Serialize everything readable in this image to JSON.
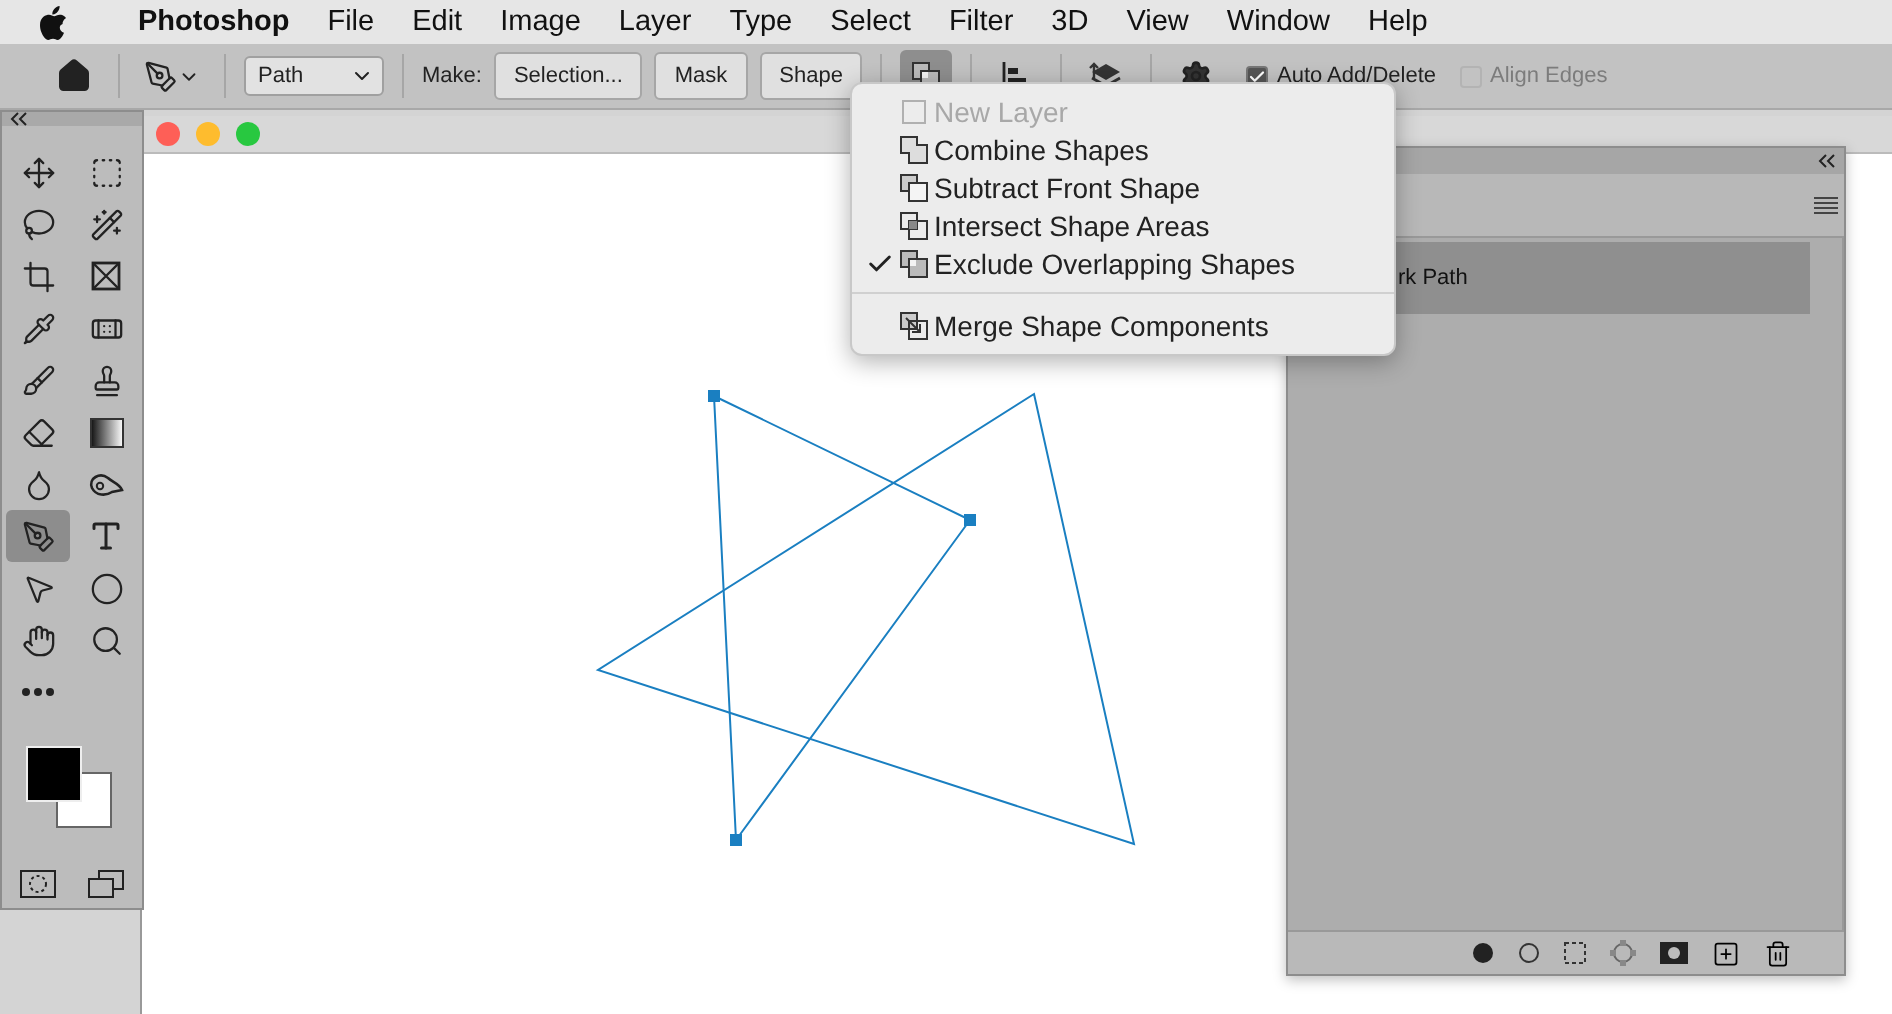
{
  "menubar": {
    "app": "Photoshop",
    "items": [
      "File",
      "Edit",
      "Image",
      "Layer",
      "Type",
      "Select",
      "Filter",
      "3D",
      "View",
      "Window",
      "Help"
    ]
  },
  "options_bar": {
    "path_mode": "Path",
    "make_label": "Make:",
    "make_buttons": [
      "Selection...",
      "Mask",
      "Shape"
    ],
    "path_operations_open": true,
    "auto_add_delete": {
      "label": "Auto Add/Delete",
      "checked": true
    },
    "align_edges": {
      "label": "Align Edges",
      "checked": false,
      "disabled": true
    }
  },
  "toolbox": {
    "tools": [
      {
        "kind": "move",
        "selected": false
      },
      {
        "kind": "marquee",
        "selected": false
      },
      {
        "kind": "lasso",
        "selected": false
      },
      {
        "kind": "wand",
        "selected": false
      },
      {
        "kind": "crop",
        "selected": false
      },
      {
        "kind": "frame",
        "selected": false
      },
      {
        "kind": "eyedropper",
        "selected": false
      },
      {
        "kind": "healing",
        "selected": false
      },
      {
        "kind": "brush",
        "selected": false
      },
      {
        "kind": "stamp",
        "selected": false
      },
      {
        "kind": "eraser",
        "selected": false
      },
      {
        "kind": "gradient",
        "selected": false
      },
      {
        "kind": "blur",
        "selected": false
      },
      {
        "kind": "smudge",
        "selected": false
      },
      {
        "kind": "pen",
        "selected": true
      },
      {
        "kind": "type",
        "selected": false
      },
      {
        "kind": "path-select",
        "selected": false
      },
      {
        "kind": "ellipse",
        "selected": false
      },
      {
        "kind": "hand",
        "selected": false
      },
      {
        "kind": "zoom",
        "selected": false
      },
      {
        "kind": "more",
        "selected": false
      }
    ]
  },
  "paths_panel": {
    "rows": [
      {
        "label": "rk Path",
        "selected": true
      }
    ]
  },
  "shape_operations_menu": {
    "items": [
      {
        "kind": "new-layer",
        "label": "New Layer",
        "disabled": true,
        "checked": false
      },
      {
        "kind": "combine",
        "label": "Combine Shapes",
        "disabled": false,
        "checked": false
      },
      {
        "kind": "subtract",
        "label": "Subtract Front Shape",
        "disabled": false,
        "checked": false
      },
      {
        "kind": "intersect",
        "label": "Intersect Shape Areas",
        "disabled": false,
        "checked": false
      },
      {
        "kind": "exclude",
        "label": "Exclude Overlapping Shapes",
        "disabled": false,
        "checked": true
      }
    ],
    "footer_items": [
      {
        "kind": "merge",
        "label": "Merge Shape Components",
        "disabled": false,
        "checked": false
      }
    ]
  }
}
